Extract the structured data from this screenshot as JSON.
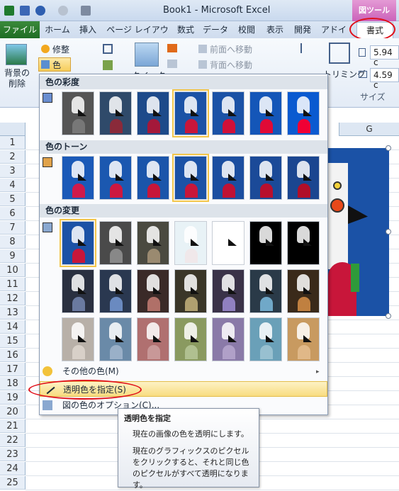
{
  "window": {
    "title": "Book1 - Microsoft Excel",
    "picture_tools_label": "図ツール"
  },
  "tabs": {
    "file": "ファイル",
    "items": [
      "ホーム",
      "挿入",
      "ページ レイアウト",
      "数式",
      "データ",
      "校閲",
      "表示",
      "開発",
      "アドイン"
    ],
    "format": "書式"
  },
  "ribbon": {
    "remove_background": "背景の\n削除",
    "corrections": "修整",
    "color": "色",
    "quick_styles": "クイック",
    "bring_forward": "前面へ移動",
    "send_backward": "背面へ移動",
    "crop": "トリミング",
    "height": "5.94 c",
    "width": "4.59 c",
    "size_group": "サイズ"
  },
  "sheet": {
    "col_g": "G",
    "rows": [
      "1",
      "2",
      "3",
      "4",
      "5",
      "6",
      "7",
      "8",
      "9",
      "10",
      "11",
      "12",
      "13",
      "14",
      "15",
      "16",
      "17",
      "18",
      "19",
      "20",
      "21",
      "22",
      "23",
      "24",
      "25"
    ]
  },
  "gallery": {
    "saturation_header": "色の彩度",
    "tone_header": "色のトーン",
    "recolor_header": "色の変更",
    "more_colors": "その他の色(M)",
    "set_transparent": "透明色を指定(S)",
    "picture_color_options": "図の色のオプション(C)..."
  },
  "tooltip": {
    "title": "透明色を指定",
    "body1": "現在の画像の色を透明にします。",
    "body2": "現在のグラフィックスのピクセルをクリックすると、それと同じ色のピクセルがすべて透明になります。"
  },
  "colors": {
    "accent_red": "#e0101a",
    "picture_blue": "#1b52a6",
    "selected_gold": "#f3c64a"
  }
}
